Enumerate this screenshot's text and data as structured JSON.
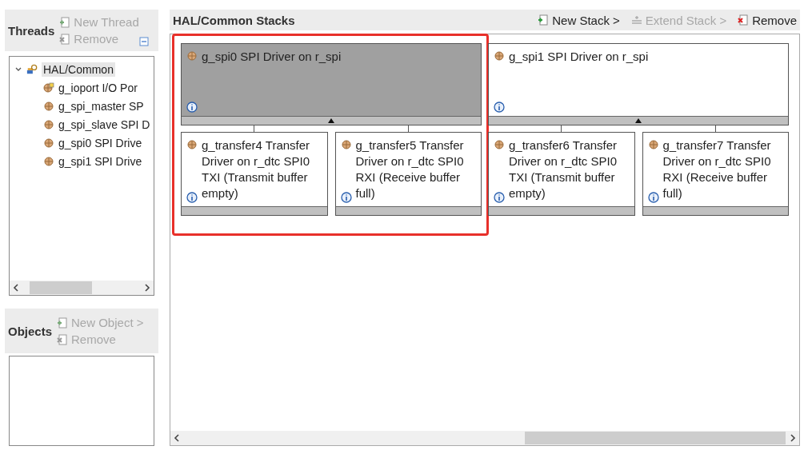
{
  "threads": {
    "title": "Threads",
    "actions": [
      {
        "label": "New Thread",
        "kind": "new",
        "disabled": true
      },
      {
        "label": "Remove",
        "kind": "remove",
        "disabled": true
      }
    ],
    "tree": [
      {
        "label": "HAL/Common",
        "expanded": true,
        "selected": true,
        "children": [
          {
            "label": "g_ioport I/O Por",
            "kind": "port"
          },
          {
            "label": "g_spi_master SP",
            "kind": "module"
          },
          {
            "label": "g_spi_slave SPI D",
            "kind": "module"
          },
          {
            "label": "g_spi0 SPI Drive",
            "kind": "module"
          },
          {
            "label": "g_spi1 SPI Drive",
            "kind": "module"
          }
        ]
      }
    ]
  },
  "objects": {
    "title": "Objects",
    "actions": [
      {
        "label": "New Object >",
        "kind": "new",
        "disabled": true
      },
      {
        "label": "Remove",
        "kind": "remove",
        "disabled": true
      }
    ]
  },
  "stacks_panel": {
    "title": "HAL/Common Stacks",
    "actions": [
      {
        "label": "New Stack >",
        "kind": "new",
        "disabled": false
      },
      {
        "label": "Extend Stack >",
        "kind": "extend",
        "disabled": true
      },
      {
        "label": "Remove",
        "kind": "remove",
        "disabled": false
      }
    ],
    "stacks": [
      {
        "title": "g_spi0 SPI Driver on r_spi",
        "selected": true,
        "highlighted": true,
        "children": [
          {
            "title": "g_transfer4 Transfer Driver on r_dtc SPI0 TXI (Transmit buffer empty)"
          },
          {
            "title": "g_transfer5 Transfer Driver on r_dtc SPI0 RXI (Receive buffer full)"
          }
        ]
      },
      {
        "title": "g_spi1 SPI Driver on r_spi",
        "selected": false,
        "highlighted": false,
        "children": [
          {
            "title": "g_transfer6 Transfer Driver on r_dtc SPI0 TXI (Transmit buffer empty)"
          },
          {
            "title": "g_transfer7 Transfer Driver on r_dtc SPI0 RXI (Receive buffer full)"
          }
        ]
      }
    ]
  }
}
